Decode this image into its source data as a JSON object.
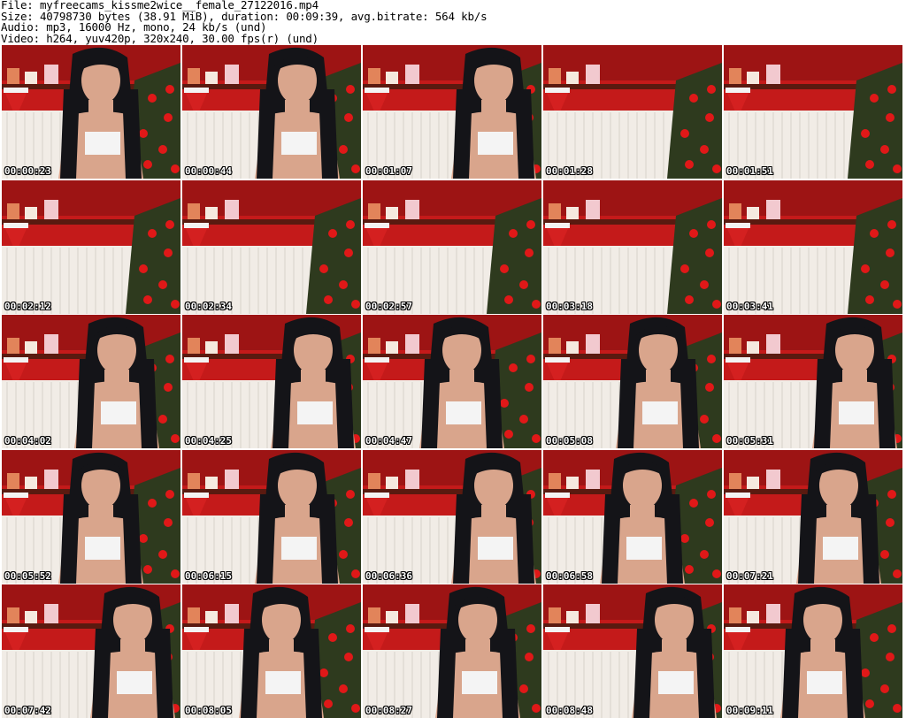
{
  "header": {
    "line1": "File: myfreecams_kissme2wice__female_27122016.mp4",
    "line2": "Size: 40798730 bytes (38.91 MiB), duration: 00:09:39, avg.bitrate: 564 kb/s",
    "line3": "Audio: mp3, 16000 Hz, mono, 24 kb/s (und)",
    "line4": "Video: h264, yuv420p, 320x240, 30.00 fps(r) (und)"
  },
  "thumbnails": [
    {
      "time": "00:00:23",
      "person": true
    },
    {
      "time": "00:00:44",
      "person": true
    },
    {
      "time": "00:01:07",
      "person": true
    },
    {
      "time": "00:01:28",
      "person": false
    },
    {
      "time": "00:01:51",
      "person": false
    },
    {
      "time": "00:02:12",
      "person": false
    },
    {
      "time": "00:02:34",
      "person": false
    },
    {
      "time": "00:02:57",
      "person": false
    },
    {
      "time": "00:03:18",
      "person": false
    },
    {
      "time": "00:03:41",
      "person": false
    },
    {
      "time": "00:04:02",
      "person": true
    },
    {
      "time": "00:04:25",
      "person": true
    },
    {
      "time": "00:04:47",
      "person": true
    },
    {
      "time": "00:05:08",
      "person": true
    },
    {
      "time": "00:05:31",
      "person": true
    },
    {
      "time": "00:05:52",
      "person": true
    },
    {
      "time": "00:06:15",
      "person": true
    },
    {
      "time": "00:06:36",
      "person": true
    },
    {
      "time": "00:06:58",
      "person": true
    },
    {
      "time": "00:07:21",
      "person": true
    },
    {
      "time": "00:07:42",
      "person": true
    },
    {
      "time": "00:08:05",
      "person": true
    },
    {
      "time": "00:08:27",
      "person": true
    },
    {
      "time": "00:08:48",
      "person": true
    },
    {
      "time": "00:09:11",
      "person": true
    }
  ],
  "colors": {
    "wall": "#c41a1a",
    "radiator": "#f1ece6",
    "shelf": "#5a1a10",
    "tree": "#2e3a1e",
    "skin": "#d9a58c",
    "hair": "#141418",
    "timestamp": "#ffffff"
  }
}
